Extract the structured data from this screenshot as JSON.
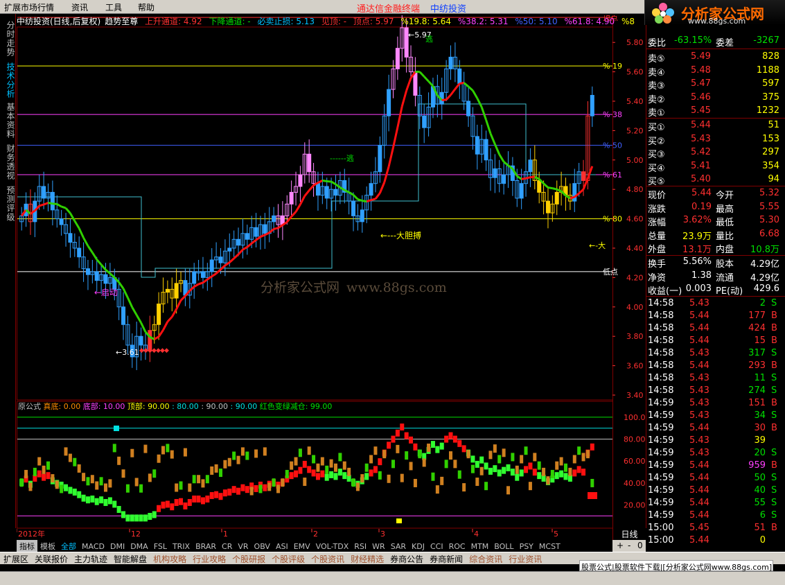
{
  "menu": {
    "items": [
      "扩展市场行情",
      "资讯",
      "工具",
      "帮助"
    ],
    "app_title": "通达信金融终端",
    "stock_title": "中纺投资"
  },
  "logo": {
    "text": "分析家公式网",
    "url": "www.88gs.com"
  },
  "sidebar": {
    "tabs": [
      "分时走势",
      "技术分析",
      "基本资料",
      "财务透视",
      "预测评级"
    ],
    "active_index": 1
  },
  "chart_header": {
    "name": "中纺投资(日线,后复权)",
    "indicator": "趋势至尊",
    "items": [
      {
        "text": "上升通道: 4.92",
        "color": "#ff3030"
      },
      {
        "text": "下降通道: -",
        "color": "#00e000"
      },
      {
        "text": "必卖止损: 5.13",
        "color": "#00c0ff"
      },
      {
        "text": "见顶: -",
        "color": "#ff3030"
      },
      {
        "text": "顶点: 5.97",
        "color": "#ff3030"
      },
      {
        "text": "%19.8: 5.64",
        "color": "#ffff00"
      },
      {
        "text": "%38.2: 5.31",
        "color": "#ff40ff"
      },
      {
        "text": "%50: 5.10",
        "color": "#4060ff"
      },
      {
        "text": "%61.8: 4.90",
        "color": "#ff40ff"
      },
      {
        "text": "%8",
        "color": "#ffff00"
      }
    ]
  },
  "price_axis": [
    "5.80",
    "5.60",
    "5.40",
    "5.20",
    "5.00",
    "4.80",
    "4.60",
    "4.40",
    "4.20",
    "4.00",
    "3.80",
    "3.60",
    "3.40"
  ],
  "fib_labels": [
    {
      "text": "顶点",
      "color": "#ff3030"
    },
    {
      "text": "% 19",
      "color": "#ffff00"
    },
    {
      "text": "% 38",
      "color": "#ff40ff"
    },
    {
      "text": "% 50",
      "color": "#4060ff"
    },
    {
      "text": "% 61",
      "color": "#ff40ff"
    },
    {
      "text": "% 80",
      "color": "#ffff00"
    },
    {
      "text": "低点",
      "color": "#ffffff"
    }
  ],
  "annotations": {
    "high": "5.97",
    "high_mark": "逃",
    "mid_mark": "逃",
    "bold": "大胆搏",
    "start": "启动",
    "low": "3.61",
    "right_mark": "大"
  },
  "sub_header": {
    "items": [
      {
        "text": "原公式",
        "color": "#c0c0c0"
      },
      {
        "text": "真底: 0.00",
        "color": "#ff8c00"
      },
      {
        "text": "底部: 10.00",
        "color": "#ff40ff"
      },
      {
        "text": "顶部: 90.00",
        "color": "#ffff00"
      },
      {
        "text": ": 80.00",
        "color": "#00e0e0"
      },
      {
        "text": ": 90.00",
        "color": "#c0c0c0"
      },
      {
        "text": ": 90.00",
        "color": "#00e0e0"
      },
      {
        "text": "红色变绿减仓: 99.00",
        "color": "#00e000"
      }
    ]
  },
  "sub_axis": [
    "100.0",
    "80.00",
    "60.00",
    "40.00",
    "20.00"
  ],
  "date_axis": [
    "2012年",
    "12",
    "1",
    "2",
    "3",
    "4",
    "5"
  ],
  "indicator_tabs": [
    "指标",
    "模板",
    "全部",
    "MACD",
    "DMI",
    "DMA",
    "FSL",
    "TRIX",
    "BRAR",
    "CR",
    "VR",
    "OBV",
    "ASI",
    "EMV",
    "VOL-TDX",
    "RSI",
    "WR",
    "SAR",
    "KDJ",
    "CCI",
    "ROC",
    "MTM",
    "BOLL",
    "PSY",
    "MCST"
  ],
  "bottom_tabs": [
    "扩展区",
    "关联报价",
    "主力轨迹",
    "智能解盘",
    "机构攻略",
    "行业攻略",
    "个股研报",
    "个股评级",
    "个股资讯",
    "财经精选",
    "券商公告",
    "券商新闻",
    "综合资讯",
    "行业资讯"
  ],
  "bottom_highlight": [
    4,
    5,
    6,
    7,
    8,
    9,
    12,
    13
  ],
  "period": "日线",
  "zoom": [
    "+",
    "-",
    "0"
  ],
  "ads": "股票公式|股票软件下载|[分析家公式网www.88gs.com]",
  "quote": {
    "top": [
      {
        "label": "委比",
        "value": "-63.15%",
        "label2": "委差",
        "value2": "-3267"
      }
    ],
    "sell": [
      {
        "label": "卖⑤",
        "price": "5.49",
        "vol": "828"
      },
      {
        "label": "卖④",
        "price": "5.48",
        "vol": "1188"
      },
      {
        "label": "卖③",
        "price": "5.47",
        "vol": "597"
      },
      {
        "label": "卖②",
        "price": "5.46",
        "vol": "375"
      },
      {
        "label": "卖①",
        "price": "5.45",
        "vol": "1232"
      }
    ],
    "buy": [
      {
        "label": "买①",
        "price": "5.44",
        "vol": "51"
      },
      {
        "label": "买②",
        "price": "5.43",
        "vol": "153"
      },
      {
        "label": "买③",
        "price": "5.42",
        "vol": "297"
      },
      {
        "label": "买④",
        "price": "5.41",
        "vol": "354"
      },
      {
        "label": "买⑤",
        "price": "5.40",
        "vol": "94"
      }
    ],
    "stats": [
      {
        "l1": "现价",
        "v1": "5.44",
        "c1": "#ff3030",
        "l2": "今开",
        "v2": "5.32",
        "c2": "#ff3030"
      },
      {
        "l1": "涨跌",
        "v1": "0.19",
        "c1": "#ff3030",
        "l2": "最高",
        "v2": "5.55",
        "c2": "#ff3030"
      },
      {
        "l1": "涨幅",
        "v1": "3.62%",
        "c1": "#ff3030",
        "l2": "最低",
        "v2": "5.30",
        "c2": "#ff3030"
      },
      {
        "l1": "总量",
        "v1": "23.9万",
        "c1": "#ffff00",
        "l2": "量比",
        "v2": "6.68",
        "c2": "#ff3030"
      },
      {
        "l1": "外盘",
        "v1": "13.1万",
        "c1": "#ff3030",
        "l2": "内盘",
        "v2": "10.8万",
        "c2": "#00e000"
      }
    ],
    "stats2": [
      {
        "l1": "换手",
        "v1": "5.56%",
        "c1": "#ffffff",
        "l2": "股本",
        "v2": "4.29亿",
        "c2": "#ffffff"
      },
      {
        "l1": "净资",
        "v1": "1.38",
        "c1": "#ffffff",
        "l2": "流通",
        "v2": "4.29亿",
        "c2": "#ffffff"
      },
      {
        "l1": "收益(一)",
        "v1": "0.003",
        "c1": "#ffffff",
        "l2": "PE(动)",
        "v2": "429.6",
        "c2": "#ffffff"
      }
    ],
    "ticks": [
      {
        "time": "14:58",
        "price": "5.43",
        "vol": "2",
        "side": "S"
      },
      {
        "time": "14:58",
        "price": "5.44",
        "vol": "177",
        "side": "B"
      },
      {
        "time": "14:58",
        "price": "5.44",
        "vol": "424",
        "side": "B"
      },
      {
        "time": "14:58",
        "price": "5.44",
        "vol": "15",
        "side": "B"
      },
      {
        "time": "14:58",
        "price": "5.43",
        "vol": "317",
        "side": "S"
      },
      {
        "time": "14:58",
        "price": "5.44",
        "vol": "293",
        "side": "B"
      },
      {
        "time": "14:58",
        "price": "5.43",
        "vol": "11",
        "side": "S"
      },
      {
        "time": "14:58",
        "price": "5.43",
        "vol": "274",
        "side": "S"
      },
      {
        "time": "14:59",
        "price": "5.43",
        "vol": "151",
        "side": "B"
      },
      {
        "time": "14:59",
        "price": "5.43",
        "vol": "34",
        "side": "S"
      },
      {
        "time": "14:59",
        "price": "5.44",
        "vol": "30",
        "side": "B"
      },
      {
        "time": "14:59",
        "price": "5.43",
        "vol": "39",
        "side": ""
      },
      {
        "time": "14:59",
        "price": "5.43",
        "vol": "20",
        "side": "S"
      },
      {
        "time": "14:59",
        "price": "5.44",
        "vol": "959",
        "side": "B"
      },
      {
        "time": "14:59",
        "price": "5.44",
        "vol": "50",
        "side": "S"
      },
      {
        "time": "14:59",
        "price": "5.44",
        "vol": "40",
        "side": "S"
      },
      {
        "time": "14:59",
        "price": "5.44",
        "vol": "55",
        "side": "S"
      },
      {
        "time": "14:59",
        "price": "5.44",
        "vol": "6",
        "side": "S"
      },
      {
        "time": "15:00",
        "price": "5.45",
        "vol": "51",
        "side": "B"
      },
      {
        "time": "15:00",
        "price": "5.44",
        "vol": "0",
        "side": ""
      }
    ]
  },
  "colors": {
    "up": "#ff3030",
    "down": "#00e000",
    "blue_candle": "#30a0ff",
    "pink_candle": "#ff88ff",
    "yellow_candle": "#ffd000",
    "grid_red": "#800000",
    "ma_green": "#30d000",
    "ma_red": "#ff1010"
  },
  "chart_data": {
    "type": "candlestick",
    "title": "中纺投资(日线,后复权) 趋势至尊",
    "ylim": [
      3.4,
      5.9
    ],
    "fib_levels": [
      {
        "name": "顶点",
        "value": 5.97
      },
      {
        "name": "%19.8",
        "value": 5.64
      },
      {
        "name": "%38.2",
        "value": 5.31
      },
      {
        "name": "%50",
        "value": 5.1
      },
      {
        "name": "%61.8",
        "value": 4.9
      },
      {
        "name": "%80",
        "value": 4.6
      },
      {
        "name": "低点",
        "value": 4.24
      }
    ],
    "closes": [
      4.62,
      4.7,
      4.58,
      4.72,
      4.82,
      4.74,
      4.78,
      4.66,
      4.6,
      4.56,
      4.5,
      4.44,
      4.4,
      4.34,
      4.26,
      4.22,
      4.24,
      4.18,
      4.22,
      4.16,
      4.2,
      4.12,
      4.0,
      3.88,
      3.74,
      3.66,
      3.8,
      3.74,
      3.7,
      3.84,
      3.88,
      4.02,
      4.1,
      4.12,
      4.06,
      4.16,
      4.18,
      4.08,
      4.16,
      4.24,
      4.24,
      4.2,
      4.24,
      4.32,
      4.34,
      4.3,
      4.38,
      4.4,
      4.46,
      4.42,
      4.5,
      4.46,
      4.54,
      4.48,
      4.56,
      4.5,
      4.58,
      4.62,
      4.56,
      4.62,
      4.7,
      4.78,
      4.82,
      4.9,
      5.04,
      4.92,
      4.84,
      4.76,
      4.82,
      4.74,
      4.8,
      4.76,
      4.86,
      4.78,
      4.72,
      4.62,
      4.58,
      4.66,
      4.76,
      4.84,
      4.92,
      5.1,
      5.3,
      5.48,
      5.62,
      5.76,
      5.9,
      5.7,
      5.6,
      5.44,
      5.3,
      5.22,
      5.36,
      5.5,
      5.38,
      5.46,
      5.62,
      5.7,
      5.62,
      5.52,
      5.4,
      5.3,
      5.16,
      5.04,
      5.14,
      5.0,
      4.88,
      4.94,
      4.84,
      4.9,
      4.96,
      4.86,
      4.74,
      4.84,
      4.92,
      5.0,
      4.86,
      4.78,
      4.72,
      4.64,
      4.7,
      4.78,
      4.82,
      4.76,
      4.72,
      4.84,
      4.92,
      4.86,
      5.3,
      5.44
    ],
    "sub_ylim": [
      0,
      105
    ]
  }
}
